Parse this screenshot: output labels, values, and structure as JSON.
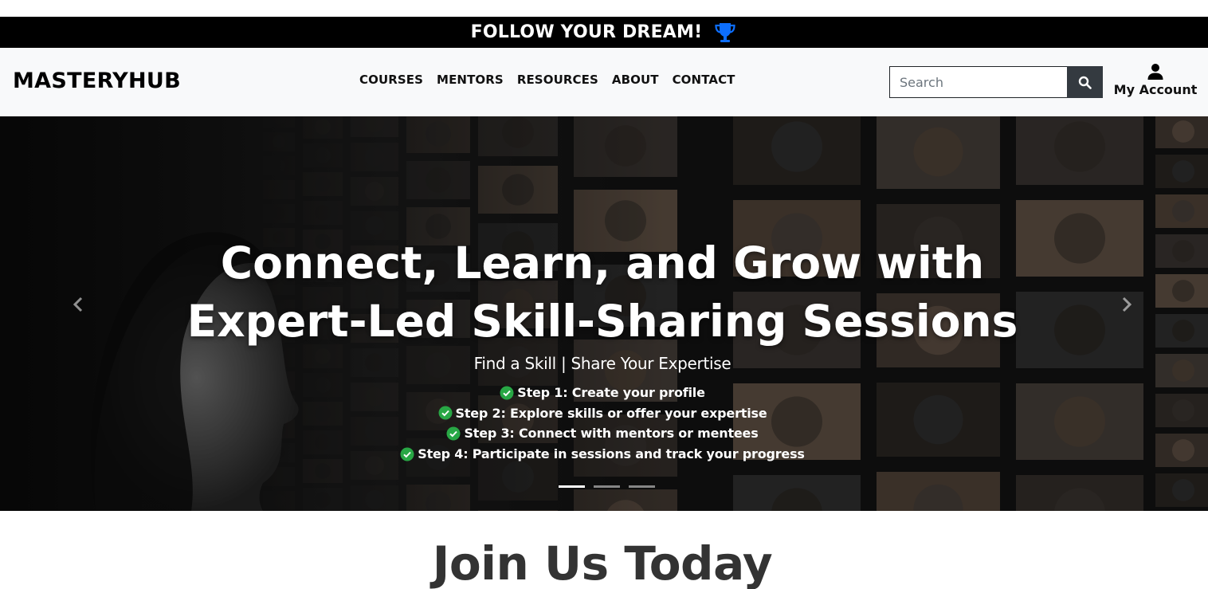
{
  "promo": {
    "text": "FOLLOW YOUR DREAM!",
    "icon": "trophy-icon",
    "icon_color": "#0d6efd"
  },
  "navbar": {
    "brand": "MASTERYHUB",
    "links": [
      "COURSES",
      "MENTORS",
      "RESOURCES",
      "ABOUT",
      "CONTACT"
    ],
    "search": {
      "placeholder": "Search",
      "value": "",
      "icon": "search-icon"
    },
    "account": {
      "label": "My Account",
      "icon": "user-icon"
    }
  },
  "hero": {
    "title_line1": "Connect, Learn, and Grow with",
    "title_line2": "Expert-Led Skill-Sharing Sessions",
    "subtitle": "Find a Skill | Share Your Expertise",
    "steps": [
      "Step 1: Create your profile",
      "Step 2: Explore skills or offer your expertise",
      "Step 3: Connect with mentors or mentees",
      "Step 4: Participate in sessions and track your progress"
    ],
    "check_color": "#28a745",
    "slides_count": 3,
    "active_slide": 1
  },
  "join": {
    "title": "Join Us Today"
  },
  "colors": {
    "promo_bg": "#000000",
    "navbar_bg": "#f8f9fa",
    "search_btn_bg": "#343a40",
    "join_text": "#333333"
  }
}
